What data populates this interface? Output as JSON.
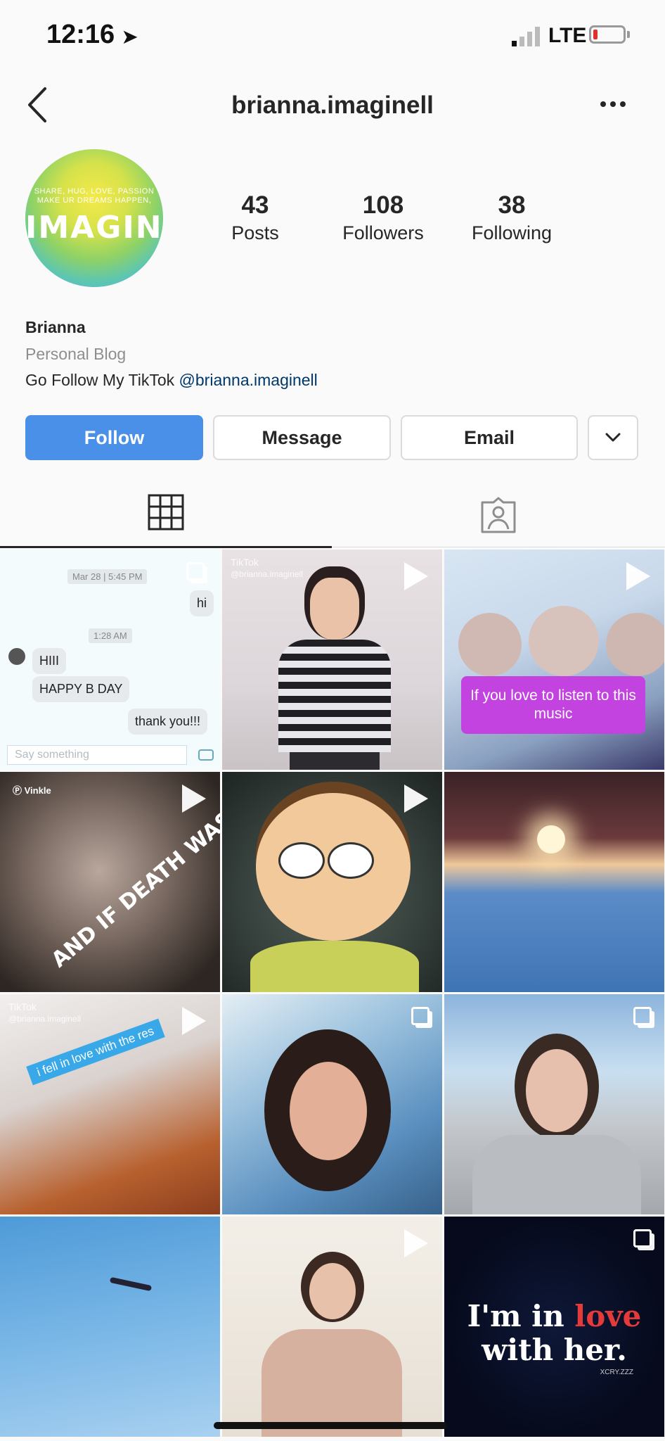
{
  "status_bar": {
    "time": "12:16",
    "network": "LTE"
  },
  "header": {
    "username": "brianna.imaginell"
  },
  "profile": {
    "avatar_text_small": "SHARE, HUG, LOVE, PASSION\nMAKE UR DREAMS HAPPEN,",
    "avatar_text_big": "IMAGINE",
    "stats": [
      {
        "value": "43",
        "label": "Posts"
      },
      {
        "value": "108",
        "label": "Followers"
      },
      {
        "value": "38",
        "label": "Following"
      }
    ],
    "name": "Brianna",
    "category": "Personal Blog",
    "bio_prefix": "Go Follow My TikTok ",
    "bio_link": "@brianna.imaginell"
  },
  "actions": {
    "follow": "Follow",
    "message": "Message",
    "email": "Email"
  },
  "grid": {
    "chat": {
      "time1": "Mar 28 | 5:45 PM",
      "msg1": "hi",
      "time2": "1:28 AM",
      "msg2": "HIII",
      "msg3": "HAPPY B DAY",
      "msg4": "thank you!!!",
      "placeholder": "Say something"
    },
    "tiktok_mark": "TikTok",
    "tiktok_handle": "@brianna.imaginell",
    "purple_caption": "If you love to listen to this music",
    "vinkle_label": "Vinkle",
    "death_caption": "AND IF DEATH WAS",
    "ribbon_caption": "i fell in love with the res",
    "love_line1_a": "I'm in ",
    "love_line1_b": "love",
    "love_line2": "with her.",
    "love_mark": "XCRY.ZZZ"
  },
  "colors": {
    "follow_button": "#4a90e8",
    "link": "#00376b"
  }
}
